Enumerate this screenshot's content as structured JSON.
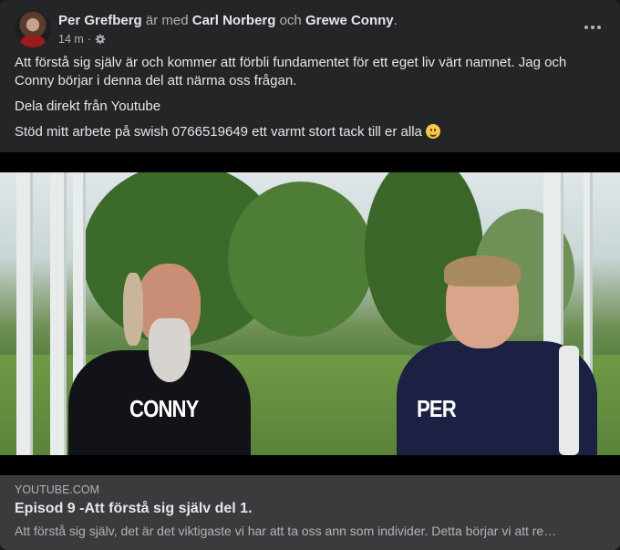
{
  "post": {
    "author": "Per Grefberg",
    "with_word": "är med",
    "tagged_1": "Carl Norberg",
    "and_word": "och",
    "tagged_2": "Grewe Conny",
    "end_punct": ".",
    "time": "14 m",
    "separator": "·",
    "privacy_icon": "gear-icon",
    "more_icon": "more-dots-icon",
    "paragraphs": [
      "Att förstå sig själv är och kommer att förbli fundamentet för ett eget liv värt namnet.  Jag och Conny börjar i denna del att närma oss frågan.",
      "Dela direkt från Youtube",
      "Stöd mitt arbete på swish 0766519649 ett varmt stort tack till er alla"
    ],
    "emoji": "smile-emoji"
  },
  "video": {
    "left_label": "CONNY",
    "right_label": "PER"
  },
  "link_preview": {
    "domain": "YOUTUBE.COM",
    "title": "Episod 9 -Att förstå sig själv del 1.",
    "description": "Att förstå sig själv, det är det viktigaste vi har att ta oss ann som individer. Detta börjar vi att re…"
  },
  "colors": {
    "card_bg": "#242526",
    "link_bg": "#3a3b3c",
    "text_primary": "#e4e6eb",
    "text_secondary": "#b0b3b8"
  }
}
